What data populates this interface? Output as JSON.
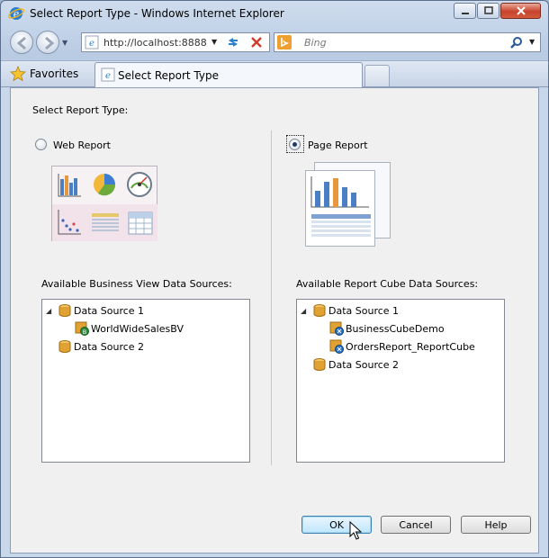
{
  "window": {
    "title": "Select Report Type - Windows Internet Explorer"
  },
  "browser": {
    "address": "http://localhost:8888/",
    "search_placeholder": "Bing",
    "favorites_label": "Favorites",
    "tab_title": "Select Report Type"
  },
  "dialog": {
    "heading": "Select Report Type:",
    "web_report": {
      "label": "Web Report",
      "selected": false,
      "data_sources_label": "Available Business View Data Sources:",
      "tree": [
        {
          "label": "Data Source 1",
          "expanded": true,
          "children": [
            {
              "label": "WorldWideSalesBV"
            }
          ]
        },
        {
          "label": "Data Source 2"
        }
      ]
    },
    "page_report": {
      "label": "Page Report",
      "selected": true,
      "data_sources_label": "Available Report Cube Data Sources:",
      "tree": [
        {
          "label": "Data Source 1",
          "expanded": true,
          "children": [
            {
              "label": "BusinessCubeDemo"
            },
            {
              "label": "OrdersReport_ReportCube"
            }
          ]
        },
        {
          "label": "Data Source 2"
        }
      ]
    },
    "buttons": {
      "ok": "OK",
      "cancel": "Cancel",
      "help": "Help"
    }
  },
  "colors": {
    "titlebar": "#cfdcee",
    "dialog_bg": "#f0f0f0",
    "default_button": "#bee6fd",
    "close_button": "#c8432c"
  }
}
